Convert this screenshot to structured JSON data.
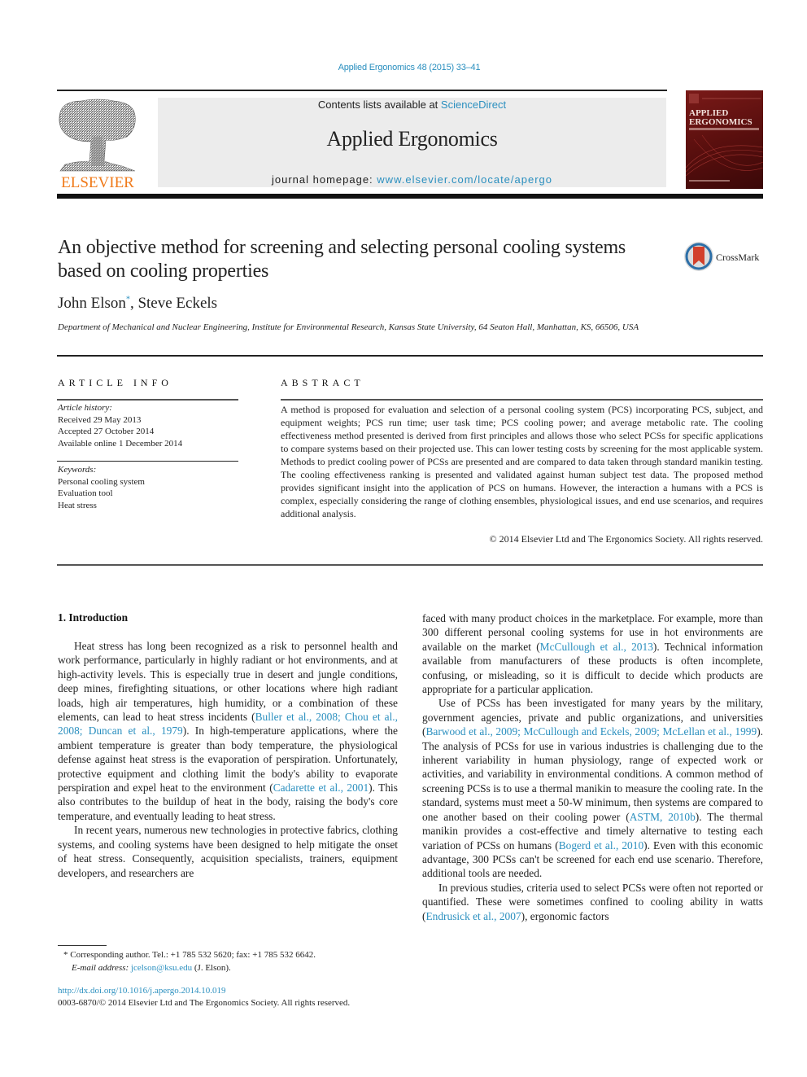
{
  "header": {
    "journal_ref": "Applied Ergonomics 48 (2015) 33–41",
    "contents_prefix": "Contents lists available at ",
    "contents_link": "ScienceDirect",
    "journal_name": "Applied Ergonomics",
    "homepage_prefix": "journal homepage: ",
    "homepage_link": "www.elsevier.com/locate/apergo",
    "publisher_logo_text": "ELSEVIER",
    "cover_title_line1": "APPLIED",
    "cover_title_line2": "ERGONOMICS",
    "crossmark_label": "CrossMark"
  },
  "article": {
    "title": "An objective method for screening and selecting personal cooling systems based on cooling properties",
    "authors": [
      {
        "name": "John Elson",
        "mark": "*"
      },
      {
        "name": "Steve Eckels",
        "mark": ""
      }
    ],
    "author_separator": ", ",
    "affiliation": "Department of Mechanical and Nuclear Engineering, Institute for Environmental Research, Kansas State University, 64 Seaton Hall, Manhattan, KS, 66506, USA"
  },
  "article_info": {
    "heading": "ARTICLE INFO",
    "history_label": "Article history:",
    "history": [
      "Received 29 May 2013",
      "Accepted 27 October 2014",
      "Available online 1 December 2014"
    ],
    "keywords_label": "Keywords:",
    "keywords": [
      "Personal cooling system",
      "Evaluation tool",
      "Heat stress"
    ]
  },
  "abstract": {
    "heading": "ABSTRACT",
    "text": "A method is proposed for evaluation and selection of a personal cooling system (PCS) incorporating PCS, subject, and equipment weights; PCS run time; user task time; PCS cooling power; and average metabolic rate. The cooling effectiveness method presented is derived from first principles and allows those who select PCSs for specific applications to compare systems based on their projected use. This can lower testing costs by screening for the most applicable system. Methods to predict cooling power of PCSs are presented and are compared to data taken through standard manikin testing. The cooling effectiveness ranking is presented and validated against human subject test data. The proposed method provides significant insight into the application of PCS on humans. However, the interaction a humans with a PCS is complex, especially considering the range of clothing ensembles, physiological issues, and end use scenarios, and requires additional analysis.",
    "copyright": "© 2014 Elsevier Ltd and The Ergonomics Society. All rights reserved."
  },
  "body": {
    "section_heading": "1.  Introduction",
    "paragraphs_left": [
      [
        {
          "t": "Heat stress has long been recognized as a risk to personnel health and work performance, particularly in highly radiant or hot environments, and at high-activity levels. This is especially true in desert and jungle conditions, deep mines, firefighting situations, or other locations where high radiant loads, high air temperatures, high humidity, or a combination of these elements, can lead to heat stress incidents ("
        },
        {
          "t": "Buller et al., 2008; Chou et al., 2008; Duncan et al., 1979",
          "link": true
        },
        {
          "t": "). In high-temperature applications, where the ambient temperature is greater than body temperature, the physiological defense against heat stress is the evaporation of perspiration. Unfortunately, protective equipment and clothing limit the body's ability to evaporate perspiration and expel heat to the environment ("
        },
        {
          "t": "Cadarette et al., 2001",
          "link": true
        },
        {
          "t": "). This also contributes to the buildup of heat in the body, raising the body's core temperature, and eventually leading to heat stress."
        }
      ],
      [
        {
          "t": "In recent years, numerous new technologies in protective fabrics, clothing systems, and cooling systems have been designed to help mitigate the onset of heat stress. Consequently, acquisition specialists, trainers, equipment developers, and researchers are"
        }
      ]
    ],
    "paragraphs_right": [
      [
        {
          "t": "faced with many product choices in the marketplace. For example, more than 300 different personal cooling systems for use in hot environments are available on the market ("
        },
        {
          "t": "McCullough et al., 2013",
          "link": true
        },
        {
          "t": "). Technical information available from manufacturers of these products is often incomplete, confusing, or misleading, so it is difficult to decide which products are appropriate for a particular application."
        }
      ],
      [
        {
          "t": "Use of PCSs has been investigated for many years by the military, government agencies, private and public organizations, and universities ("
        },
        {
          "t": "Barwood et al., 2009; McCullough and Eckels, 2009; McLellan et al., 1999",
          "link": true
        },
        {
          "t": "). The analysis of PCSs for use in various industries is challenging due to the inherent variability in human physiology, range of expected work or activities, and variability in environmental conditions. A common method of screening PCSs is to use a thermal manikin to measure the cooling rate. In the standard, systems must meet a 50-W minimum, then systems are compared to one another based on their cooling power ("
        },
        {
          "t": "ASTM, 2010b",
          "link": true
        },
        {
          "t": "). The thermal manikin provides a cost-effective and timely alternative to testing each variation of PCSs on humans ("
        },
        {
          "t": "Bogerd et al., 2010",
          "link": true
        },
        {
          "t": "). Even with this economic advantage, 300 PCSs can't be screened for each end use scenario. Therefore, additional tools are needed."
        }
      ],
      [
        {
          "t": "In previous studies, criteria used to select PCSs were often not reported or quantified. These were sometimes confined to cooling ability in watts ("
        },
        {
          "t": "Endrusick et al., 2007",
          "link": true
        },
        {
          "t": "), ergonomic factors"
        }
      ]
    ]
  },
  "footnote": {
    "mark": "*",
    "text": " Corresponding author. Tel.: +1 785 532 5620; fax: +1 785 532 6642.",
    "email_label": "E-mail address: ",
    "email": "jcelson@ksu.edu",
    "email_suffix": " (J. Elson).",
    "doi": "http://dx.doi.org/10.1016/j.apergo.2014.10.019",
    "issn": "0003-6870/© 2014 Elsevier Ltd and The Ergonomics Society. All rights reserved."
  },
  "colors": {
    "link": "#2a8fbf",
    "elsevier_orange": "#f07a1a",
    "cover_red": "#7a1a18"
  }
}
